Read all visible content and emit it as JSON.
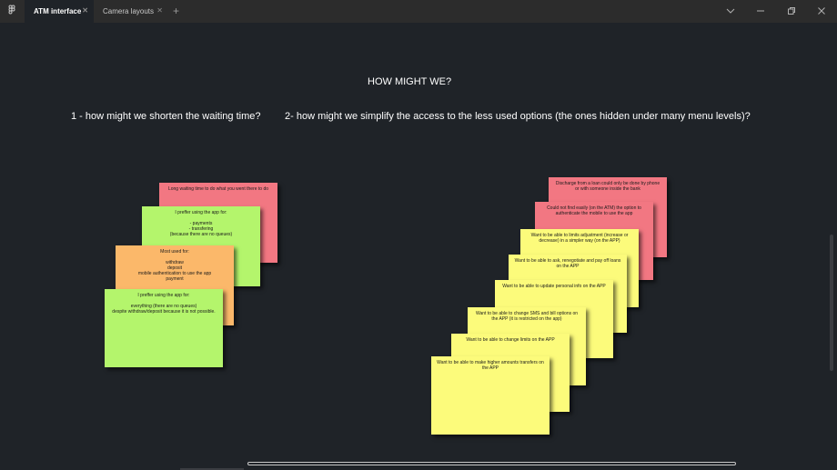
{
  "tabs": [
    {
      "label": "ATM interface",
      "active": true
    },
    {
      "label": "Camera layouts",
      "active": false
    }
  ],
  "icons": {
    "app": "figma-icon",
    "close": "close-icon",
    "add": "plus-icon",
    "dropdown": "chevron-down-icon",
    "minimize": "minimize-icon",
    "restore": "restore-icon",
    "close_window": "close-window-icon"
  },
  "canvas": {
    "heading": "HOW MIGHT WE?",
    "question1": "1 - how might we shorten the waiting time?",
    "question2": "2- how might we simplify the access to the less used options (the ones hidden under many menu levels)?"
  },
  "notes_left": [
    {
      "text": "Long waiting time to do what you went there to do",
      "color": "red"
    },
    {
      "text": "I preffer using the app for:\n\n- payments\n- transfering\n(because there are no queues)",
      "color": "green"
    },
    {
      "text": "Most used for:\n\nwithdraw\ndeposit\nmobile authentication to use the app\npayment",
      "color": "orange"
    },
    {
      "text": "I preffer using the app for:\n\neverything (there are no queues)\ndespite withdraw/deposit because it is not possible.",
      "color": "green"
    }
  ],
  "notes_right": [
    {
      "text": "Discharge from a loan could only be done by phone or with someone inside the bank",
      "color": "red"
    },
    {
      "text": "Could not find easily (on the ATM) the option to authenticate the mobile to use the app",
      "color": "red"
    },
    {
      "text": "Want to be able to limits adjustment (increase or decrease) in a simpler way (on the APP)",
      "color": "yellow"
    },
    {
      "text": "Want to be able to ask, renegotiate and pay off loans on the APP",
      "color": "yellow"
    },
    {
      "text": "Want to be able to update personal info on the APP",
      "color": "yellow"
    },
    {
      "text": "Want to be able to change SMS and bill options on the APP (it is restricted on the app)",
      "color": "yellow"
    },
    {
      "text": "Want to be able to change limits on the APP",
      "color": "yellow"
    },
    {
      "text": "Want to be able to make higher amounts transfers on the APP",
      "color": "yellow"
    }
  ],
  "colors": {
    "background": "#1f2328",
    "tabbar": "#2c2c2c",
    "red": "#f27782",
    "green": "#b4f56c",
    "orange": "#fbb86a",
    "yellow": "#fcfb7b"
  }
}
